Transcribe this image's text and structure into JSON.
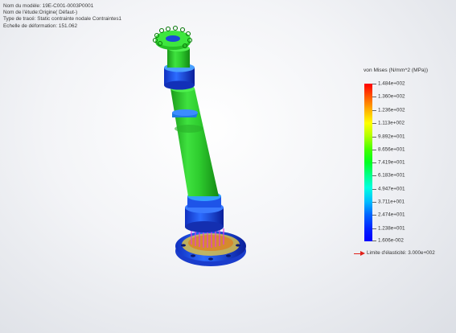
{
  "info": {
    "model_name": "Nom du modèle: 19E-C001-0003P0001",
    "study_name": "Nom de l'étude:Origine( Défaut-)",
    "plot_type": "Type de tracé: Static contrainte nodale Contraintes1",
    "deformation_scale": "Echelle de déformation: 151.062"
  },
  "legend": {
    "title": "von Mises (N/mm^2 (MPa))",
    "ticks": [
      "1.484e+002",
      "1.360e+002",
      "1.236e+002",
      "1.113e+002",
      "9.892e+001",
      "8.656e+001",
      "7.419e+001",
      "6.183e+001",
      "4.947e+001",
      "3.711e+001",
      "2.474e+001",
      "1.238e+001",
      "1.606e-002"
    ],
    "yield": "Limite d'élasticité: 3.000e+002",
    "colors": {
      "max": "#ff0000",
      "mid": "#00ff22",
      "min": "#0000ff",
      "yield_marker": "#e0201a"
    }
  }
}
